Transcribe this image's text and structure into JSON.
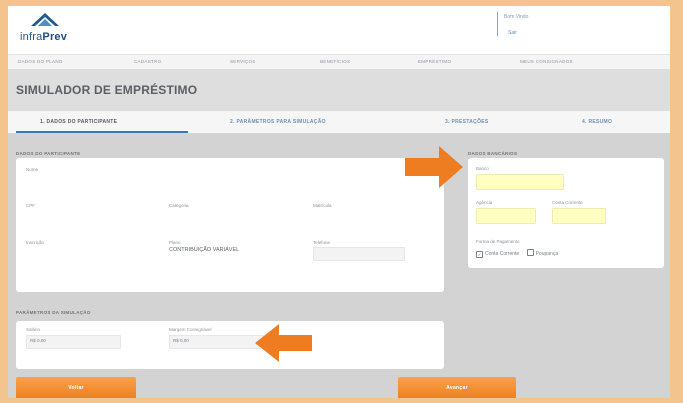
{
  "header": {
    "logo_prefix": "infra",
    "logo_suffix": "Prev",
    "user_name": "Bom Vindo",
    "user_exit": "Sair"
  },
  "nav": {
    "items": [
      "DADOS DO PLANO",
      "CADASTRO",
      "SERVIÇOS",
      "BENEFÍCIOS",
      "EMPRÉSTIMO",
      "MEUS CONSIGNADOS"
    ]
  },
  "page": {
    "title": "SIMULADOR DE EMPRÉSTIMO"
  },
  "steps": [
    "1. DADOS DO PARTICIPANTE",
    "2. PARÂMETROS PARA SIMULAÇÃO",
    "3. PRESTAÇÕES",
    "4. RESUMO"
  ],
  "participant": {
    "section_title": "DADOS DO PARTICIPANTE",
    "nome_label": "Nome",
    "cpf_label": "CPF",
    "categoria_label": "Categoria",
    "matricula_label": "Matrícula",
    "inscricao_label": "Inscrição",
    "plano_label": "Plano",
    "plano_value": "CONTRIBUIÇÃO VARIÁVEL",
    "telefone_label": "Telefone"
  },
  "bank": {
    "section_title": "DADOS BANCÁRIOS",
    "banco_label": "Banco",
    "agencia_label": "Agência",
    "conta_label": "Conta Corrente",
    "pagamento_label": "Forma de Pagamento",
    "option_conta": "Conta Corrente",
    "option_poupanca": "Poupança"
  },
  "simulation": {
    "section_title": "PARÂMETROS DA SIMULAÇÃO",
    "salario_label": "Salário",
    "salario_value": "R$ 0,00",
    "margem_label": "Margem Consignável",
    "margem_value": "R$ 0,00"
  },
  "buttons": {
    "back": "Voltar",
    "next": "Avançar"
  },
  "colors": {
    "accent_orange": "#ef7f1c",
    "tab_blue": "#2f7ac0",
    "highlight_yellow": "#ffffc2"
  }
}
